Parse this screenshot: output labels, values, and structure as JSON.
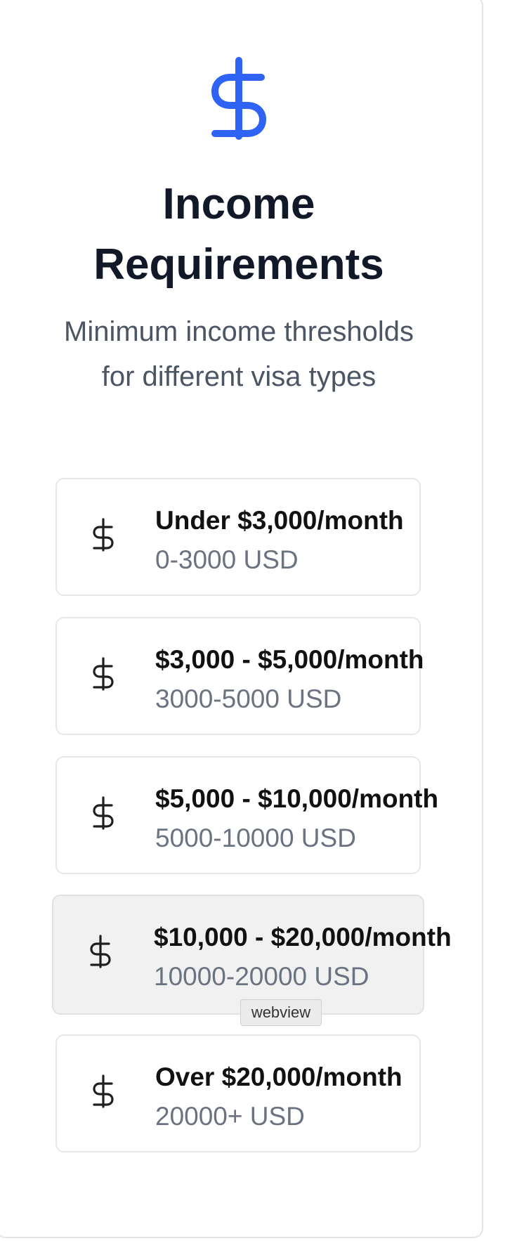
{
  "header": {
    "icon": "dollar-sign-icon",
    "title": "Income Requirements",
    "subtitle": "Minimum income thresholds for different visa types"
  },
  "options": [
    {
      "label": "Under $3,000/month",
      "range": "0-3000 USD",
      "icon": "dollar-sign-icon"
    },
    {
      "label": "$3,000 - $5,000/month",
      "range": "3000-5000 USD",
      "icon": "dollar-sign-icon"
    },
    {
      "label": "$5,000 - $10,000/month",
      "range": "5000-10000 USD",
      "icon": "dollar-sign-icon"
    },
    {
      "label": "$10,000 - $20,000/month",
      "range": "10000-20000 USD",
      "icon": "dollar-sign-icon"
    },
    {
      "label": "Over $20,000/month",
      "range": "20000+ USD",
      "icon": "dollar-sign-icon"
    }
  ],
  "tooltip": {
    "text": "webview"
  },
  "colors": {
    "accent": "#2f63f5",
    "title": "#111827",
    "subtitle": "#4b5563",
    "range_text": "#6b7280",
    "hover_bg": "#f1f1f2"
  }
}
